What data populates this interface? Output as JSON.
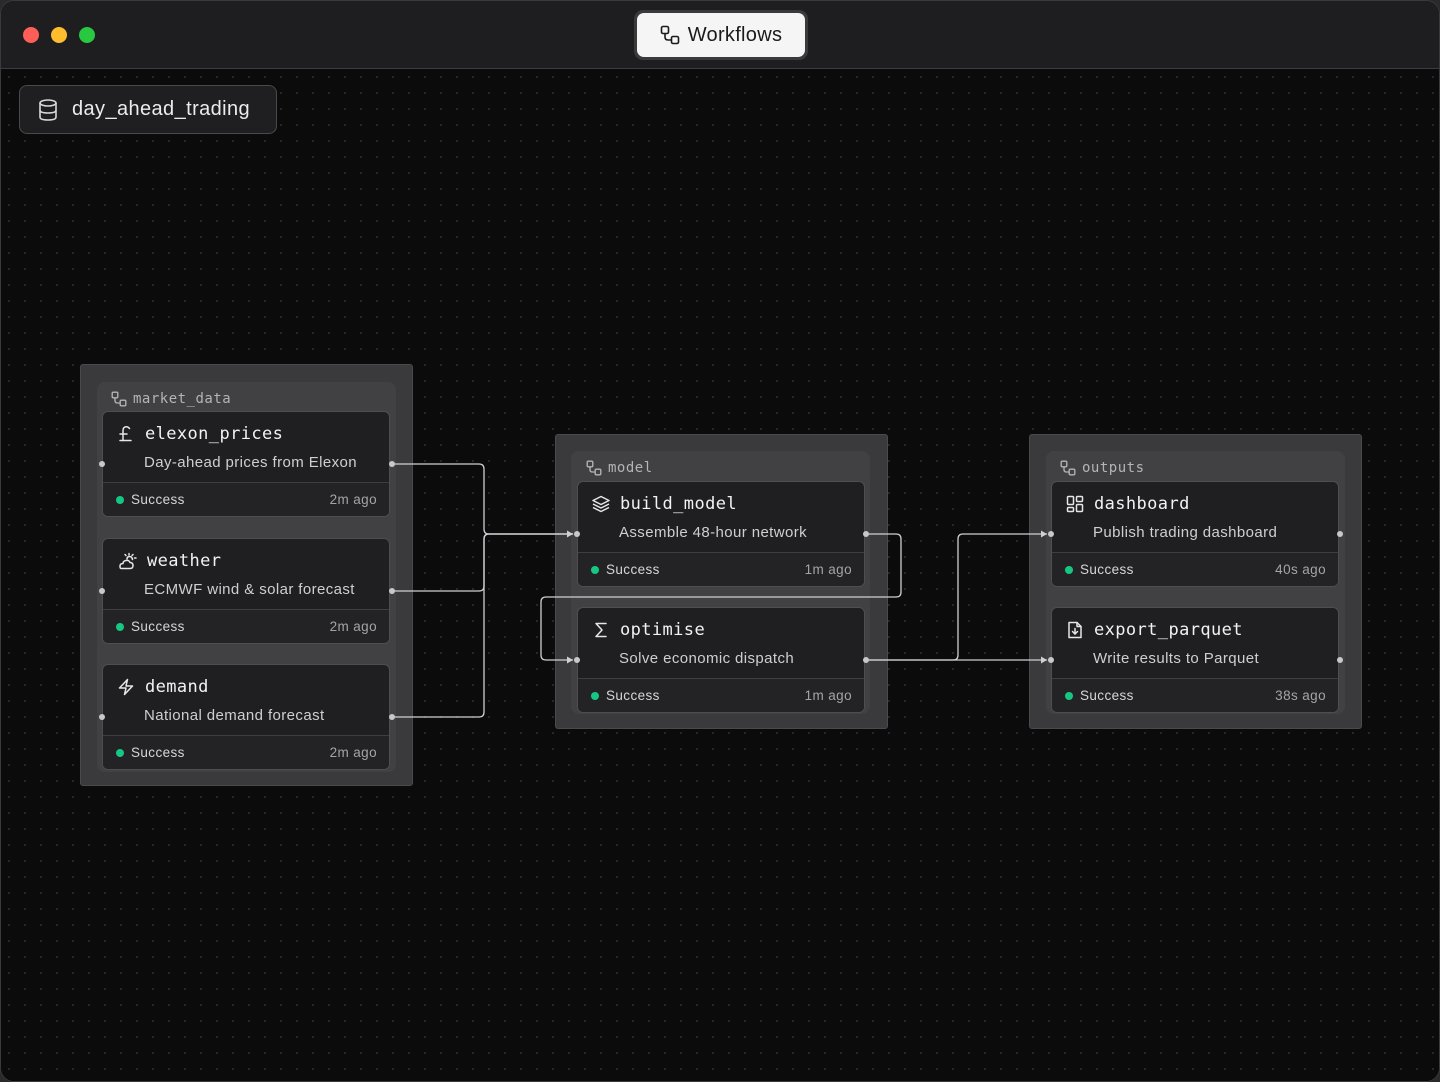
{
  "window": {
    "title": "Workflows"
  },
  "project": {
    "name": "day_ahead_trading"
  },
  "groups": [
    {
      "label": "market_data"
    },
    {
      "label": "model"
    },
    {
      "label": "outputs"
    }
  ],
  "nodes": {
    "elexon_prices": {
      "title": "elexon_prices",
      "description": "Day-ahead prices from Elexon",
      "status": "Success",
      "time": "2m ago",
      "icon": "pound-icon"
    },
    "weather": {
      "title": "weather",
      "description": "ECMWF wind & solar forecast",
      "status": "Success",
      "time": "2m ago",
      "icon": "weather-icon"
    },
    "demand": {
      "title": "demand",
      "description": "National demand forecast",
      "status": "Success",
      "time": "2m ago",
      "icon": "bolt-icon"
    },
    "build_model": {
      "title": "build_model",
      "description": "Assemble 48-hour network",
      "status": "Success",
      "time": "1m ago",
      "icon": "layers-icon"
    },
    "optimise": {
      "title": "optimise",
      "description": "Solve economic dispatch",
      "status": "Success",
      "time": "1m ago",
      "icon": "sigma-icon"
    },
    "dashboard": {
      "title": "dashboard",
      "description": "Publish trading dashboard",
      "status": "Success",
      "time": "40s ago",
      "icon": "dashboard-icon"
    },
    "export_parquet": {
      "title": "export_parquet",
      "description": "Write results to Parquet",
      "status": "Success",
      "time": "38s ago",
      "icon": "file-download-icon"
    }
  },
  "colors": {
    "success": "#16c784",
    "edge": "#d0d0d4",
    "background": "#0b0b0c"
  }
}
